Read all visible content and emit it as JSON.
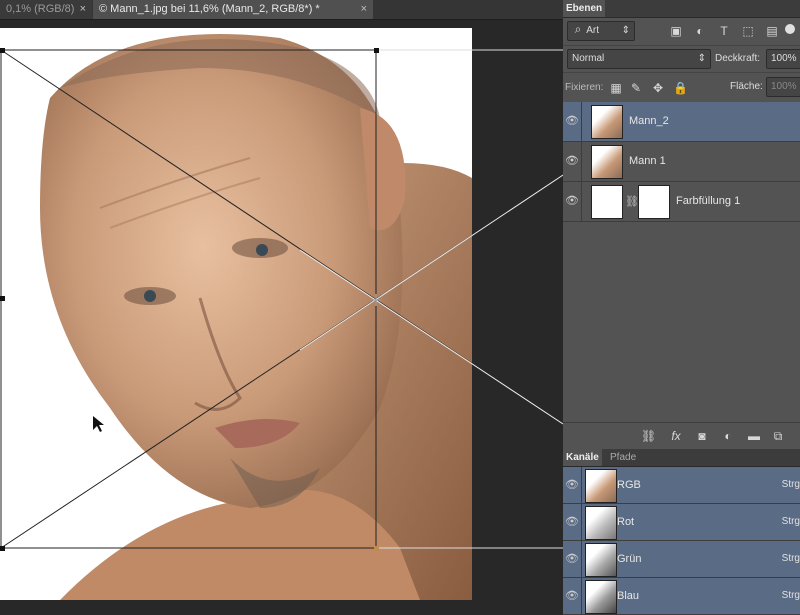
{
  "document_tabs": [
    {
      "title": "0,1% (RGB/8)",
      "close": "×"
    },
    {
      "title": "© Mann_1.jpg bei 11,6% (Mann_2, RGB/8*) *",
      "close": "×"
    }
  ],
  "layers_panel": {
    "tab": "Ebenen",
    "filter_kind": "Art",
    "blend_mode": "Normal",
    "opacity_label": "Deckkraft:",
    "opacity_value": "100%",
    "lock_label": "Fixieren:",
    "fill_label": "Fläche:",
    "fill_value": "100%",
    "layers": [
      {
        "name": "Mann_2",
        "selected": true
      },
      {
        "name": "Mann 1",
        "selected": false
      },
      {
        "name": "Farbfüllung 1",
        "selected": false
      }
    ],
    "footer_icons": [
      "link-icon",
      "fx-icon",
      "mask-icon",
      "adjustment-icon",
      "folder-icon",
      "new-layer-icon"
    ]
  },
  "channels_panel": {
    "tabs": [
      "Kanäle",
      "Pfade"
    ],
    "channels": [
      {
        "name": "RGB",
        "shortcut": "Strg"
      },
      {
        "name": "Rot",
        "shortcut": "Strg"
      },
      {
        "name": "Grün",
        "shortcut": "Strg"
      },
      {
        "name": "Blau",
        "shortcut": "Strg"
      }
    ]
  },
  "colors": {
    "selected_row": "#5a6b85",
    "panel_bg": "#535353",
    "canvas_bg": "#282828"
  }
}
